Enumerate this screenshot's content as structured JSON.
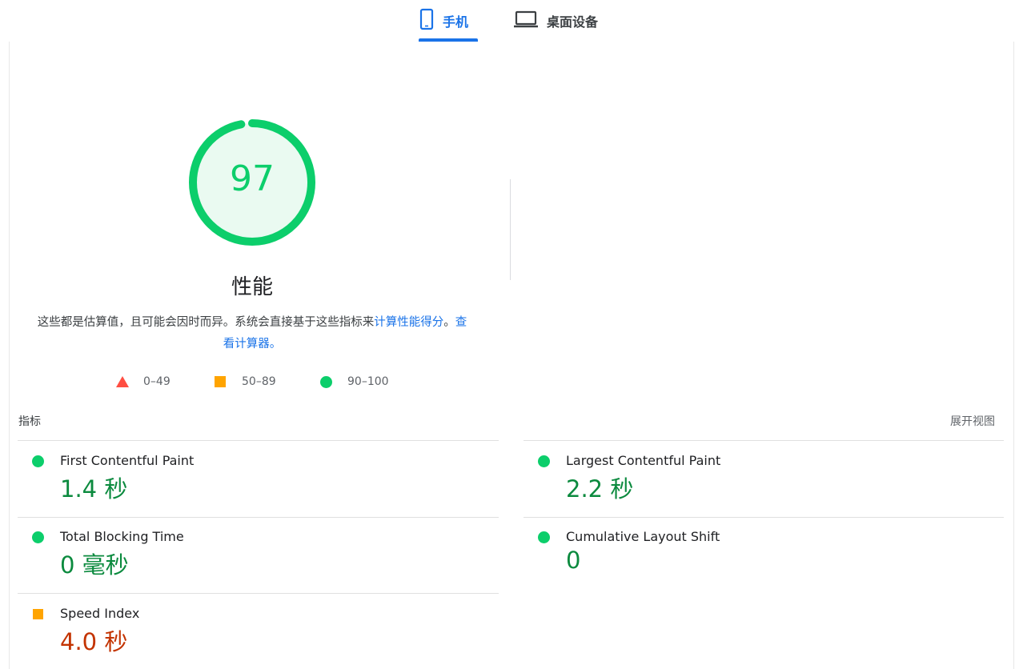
{
  "tabs": [
    {
      "label": "手机",
      "icon": "smartphone-icon",
      "active": true
    },
    {
      "label": "桌面设备",
      "icon": "laptop-icon",
      "active": false
    }
  ],
  "gauge": {
    "score": "97",
    "score_fraction": 0.97,
    "title": "性能",
    "color": "#0cce6b"
  },
  "description": {
    "text": "这些都是估算值，且可能会因时而异。系统会直接基于这些指标来",
    "link1": "计算性能得分",
    "mid": "。",
    "link2": "查看计算器。"
  },
  "legend": {
    "fail": "0–49",
    "average": "50–89",
    "pass": "90–100"
  },
  "metrics": {
    "label": "指标",
    "expand": "展开视图",
    "fcp": {
      "name": "First Contentful Paint",
      "value": "1.4 秒",
      "rating": "pass"
    },
    "lcp": {
      "name": "Largest Contentful Paint",
      "value": "2.2 秒",
      "rating": "pass"
    },
    "tbt": {
      "name": "Total Blocking Time",
      "value": "0 毫秒",
      "rating": "pass"
    },
    "cls": {
      "name": "Cumulative Layout Shift",
      "value": "0",
      "rating": "pass"
    },
    "si": {
      "name": "Speed Index",
      "value": "4.0 秒",
      "rating": "average"
    }
  },
  "colors": {
    "pass": "#0cce6b",
    "average": "#ffa400",
    "fail": "#ff4e42",
    "accent": "#1a73e8"
  }
}
